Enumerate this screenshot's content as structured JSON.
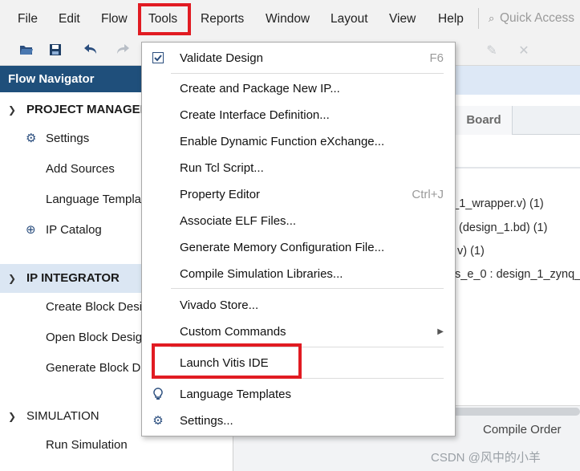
{
  "menubar": {
    "items": [
      "File",
      "Edit",
      "Flow",
      "Tools",
      "Reports",
      "Window",
      "Layout",
      "View",
      "Help"
    ],
    "quick_access_placeholder": "Quick Access"
  },
  "toolbar": {
    "icons": [
      "open-folder-icon",
      "save-icon",
      "undo-icon",
      "redo-icon"
    ]
  },
  "flow_navigator": {
    "title": "Flow Navigator",
    "project_manager": {
      "label": "PROJECT MANAGER",
      "items": [
        "Settings",
        "Add Sources",
        "Language Templates",
        "IP Catalog"
      ]
    },
    "ip_integrator": {
      "label": "IP INTEGRATOR",
      "items": [
        "Create Block Design",
        "Open Block Design",
        "Generate Block Design"
      ]
    },
    "simulation": {
      "label": "SIMULATION",
      "items": [
        "Run Simulation"
      ]
    }
  },
  "right_panel": {
    "board_tab": "Board",
    "source_lines": [
      "gn_1_wrapper.v) (1)",
      "(design_1.bd) (1)",
      "v) (1)",
      "s_e_0 : design_1_zynq_"
    ],
    "compile_order": "Compile Order",
    "watermark": "CSDN @风中的小羊"
  },
  "tools_menu": {
    "items": [
      {
        "label": "Validate Design",
        "shortcut": "F6",
        "icon": "checkbox-icon"
      },
      {
        "label": "Create and Package New IP..."
      },
      {
        "label": "Create Interface Definition..."
      },
      {
        "label": "Enable Dynamic Function eXchange..."
      },
      {
        "label": "Run Tcl Script..."
      },
      {
        "label": "Property Editor",
        "shortcut": "Ctrl+J"
      },
      {
        "label": "Associate ELF Files..."
      },
      {
        "label": "Generate Memory Configuration File..."
      },
      {
        "label": "Compile Simulation Libraries..."
      },
      {
        "label": "Vivado Store..."
      },
      {
        "label": "Custom Commands",
        "submenu": true
      },
      {
        "label": "Launch Vitis IDE"
      },
      {
        "label": "Language Templates",
        "icon": "lightbulb-icon"
      },
      {
        "label": "Settings...",
        "icon": "gear-icon"
      }
    ]
  },
  "colors": {
    "highlight": "#e11b22",
    "nav_header": "#1f4f7b",
    "selected_section": "#dbe6f3"
  }
}
